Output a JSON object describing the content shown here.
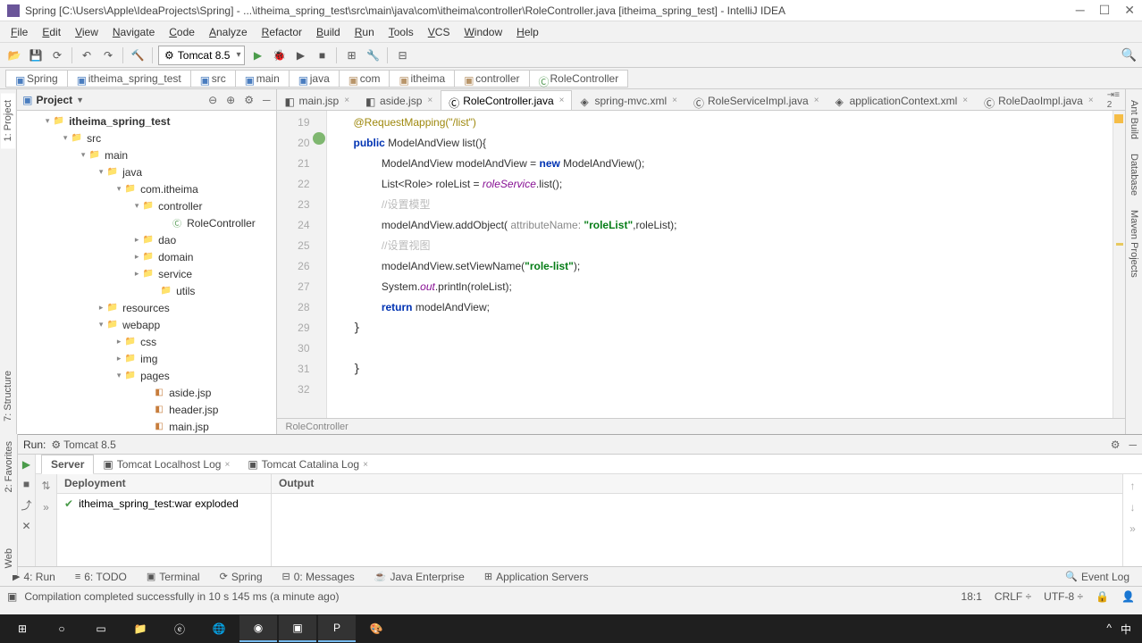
{
  "titlebar": {
    "text": "Spring [C:\\Users\\Apple\\IdeaProjects\\Spring] - ...\\itheima_spring_test\\src\\main\\java\\com\\itheima\\controller\\RoleController.java [itheima_spring_test] - IntelliJ IDEA"
  },
  "menu": [
    "File",
    "Edit",
    "View",
    "Navigate",
    "Code",
    "Analyze",
    "Refactor",
    "Build",
    "Run",
    "Tools",
    "VCS",
    "Window",
    "Help"
  ],
  "toolbar": {
    "run_config": "Tomcat 8.5"
  },
  "breadcrumb": [
    "Spring",
    "itheima_spring_test",
    "src",
    "main",
    "java",
    "com",
    "itheima",
    "controller",
    "RoleController"
  ],
  "project_panel": {
    "title": "Project",
    "tree": [
      {
        "indent": 28,
        "toggle": "▾",
        "icon": "folder-blue",
        "label": "itheima_spring_test",
        "bold": true
      },
      {
        "indent": 48,
        "toggle": "▾",
        "icon": "folder-blue",
        "label": "src"
      },
      {
        "indent": 68,
        "toggle": "▾",
        "icon": "folder-blue",
        "label": "main"
      },
      {
        "indent": 88,
        "toggle": "▾",
        "icon": "folder-blue",
        "label": "java"
      },
      {
        "indent": 108,
        "toggle": "▾",
        "icon": "folder",
        "label": "com.itheima"
      },
      {
        "indent": 128,
        "toggle": "▾",
        "icon": "folder",
        "label": "controller"
      },
      {
        "indent": 160,
        "toggle": "",
        "icon": "class",
        "label": "RoleController"
      },
      {
        "indent": 128,
        "toggle": "▸",
        "icon": "folder",
        "label": "dao"
      },
      {
        "indent": 128,
        "toggle": "▸",
        "icon": "folder",
        "label": "domain"
      },
      {
        "indent": 128,
        "toggle": "▸",
        "icon": "folder",
        "label": "service"
      },
      {
        "indent": 148,
        "toggle": "",
        "icon": "folder",
        "label": "utils"
      },
      {
        "indent": 88,
        "toggle": "▸",
        "icon": "folder",
        "label": "resources"
      },
      {
        "indent": 88,
        "toggle": "▾",
        "icon": "folder-blue",
        "label": "webapp"
      },
      {
        "indent": 108,
        "toggle": "▸",
        "icon": "folder",
        "label": "css"
      },
      {
        "indent": 108,
        "toggle": "▸",
        "icon": "folder",
        "label": "img"
      },
      {
        "indent": 108,
        "toggle": "▾",
        "icon": "folder",
        "label": "pages"
      },
      {
        "indent": 140,
        "toggle": "",
        "icon": "jsp",
        "label": "aside.jsp"
      },
      {
        "indent": 140,
        "toggle": "",
        "icon": "jsp",
        "label": "header.jsp"
      },
      {
        "indent": 140,
        "toggle": "",
        "icon": "jsp",
        "label": "main.jsp"
      }
    ]
  },
  "side_tabs_left": [
    "1: Project",
    "7: Structure"
  ],
  "side_tabs_left2": [
    "2: Favorites",
    "Web"
  ],
  "side_tabs_right": [
    "Ant Build",
    "Database",
    "Maven Projects"
  ],
  "editor_tabs": [
    {
      "label": "main.jsp",
      "active": false,
      "icon": "jsp"
    },
    {
      "label": "aside.jsp",
      "active": false,
      "icon": "jsp"
    },
    {
      "label": "RoleController.java",
      "active": true,
      "icon": "class"
    },
    {
      "label": "spring-mvc.xml",
      "active": false,
      "icon": "xml"
    },
    {
      "label": "RoleServiceImpl.java",
      "active": false,
      "icon": "class"
    },
    {
      "label": "applicationContext.xml",
      "active": false,
      "icon": "xml"
    },
    {
      "label": "RoleDaoImpl.java",
      "active": false,
      "icon": "class"
    }
  ],
  "editor_extra": "⇥≡ 2",
  "code_lines": {
    "l19": "@RequestMapping(\"/list\")",
    "l20_pre": "public ",
    "l20_mid": "ModelAndView list(){",
    "l21_a": "ModelAndView modelAndView = ",
    "l21_b": "new",
    "l21_c": " ModelAndView();",
    "l22_a": "List<Role> roleList = ",
    "l22_b": "roleService",
    "l22_c": ".list();",
    "l23": "//设置模型",
    "l24_a": "modelAndView.addObject( ",
    "l24_b": "attributeName: ",
    "l24_c": "\"roleList\"",
    "l24_d": ",roleList);",
    "l25": "//设置视图",
    "l26_a": "modelAndView.setViewName(",
    "l26_b": "\"role-list\"",
    "l26_c": ");",
    "l27_a": "System.",
    "l27_b": "out",
    "l27_c": ".println(roleList);",
    "l28_a": "return",
    "l28_b": " modelAndView;"
  },
  "gutter": [
    "19",
    "20",
    "21",
    "22",
    "23",
    "24",
    "25",
    "26",
    "27",
    "28",
    "29",
    "30",
    "31",
    "32"
  ],
  "editor_status": "RoleController",
  "run": {
    "title": "Run:",
    "config": "Tomcat 8.5",
    "tabs": [
      {
        "label": "Server",
        "active": true
      },
      {
        "label": "Tomcat Localhost Log",
        "active": false
      },
      {
        "label": "Tomcat Catalina Log",
        "active": false
      }
    ],
    "deploy_header": "Deployment",
    "output_header": "Output",
    "deploy_item": "itheima_spring_test:war exploded"
  },
  "bottom_tabs": [
    "4: Run",
    "6: TODO",
    "Terminal",
    "Spring",
    "0: Messages",
    "Java Enterprise",
    "Application Servers"
  ],
  "bottom_right": "Event Log",
  "status": {
    "msg": "Compilation completed successfully in 10 s 145 ms (a minute ago)",
    "pos": "18:1",
    "eol": "CRLF",
    "enc": "UTF-8"
  },
  "taskbar_right": [
    "^",
    "中"
  ]
}
